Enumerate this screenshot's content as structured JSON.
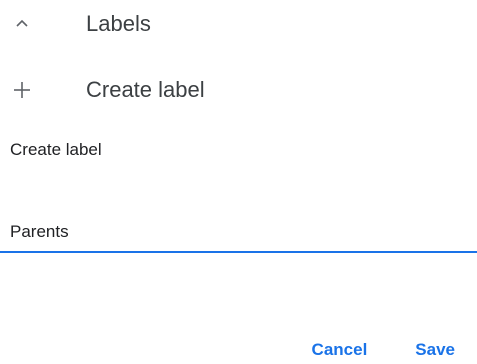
{
  "labels_section": {
    "title": "Labels",
    "toggle_icon": "chevron-up-icon"
  },
  "create_row": {
    "label": "Create label",
    "icon": "plus-icon"
  },
  "dialog": {
    "title": "Create label",
    "input_value": "Parents",
    "cancel_label": "Cancel",
    "save_label": "Save"
  },
  "colors": {
    "accent": "#1a73e8",
    "text": "#202124",
    "icon": "#5f6368"
  }
}
